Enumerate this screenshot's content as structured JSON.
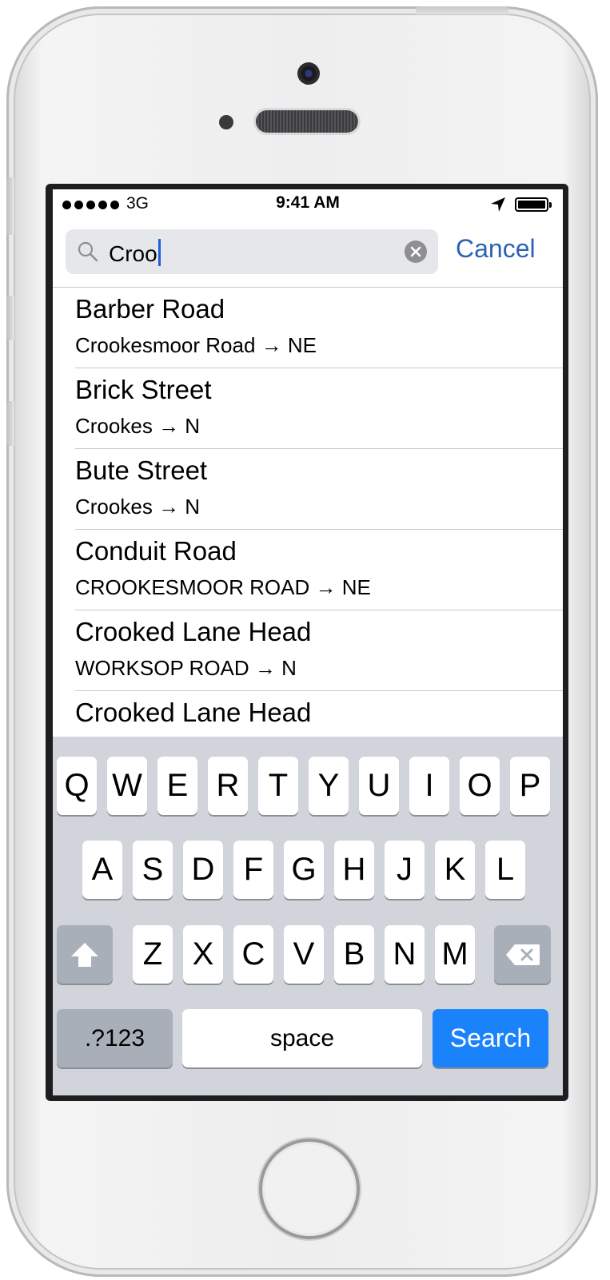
{
  "status_bar": {
    "carrier": "3G",
    "time": "9:41 AM",
    "signal_dots": 5
  },
  "search": {
    "query": "Croo",
    "cancel_label": "Cancel"
  },
  "results": [
    {
      "title": "Barber Road",
      "subtitle": "Crookesmoor Road → NE"
    },
    {
      "title": "Brick Street",
      "subtitle": "Crookes → N"
    },
    {
      "title": "Bute Street",
      "subtitle": "Crookes → N"
    },
    {
      "title": "Conduit Road",
      "subtitle": "CROOKESMOOR ROAD → NE"
    },
    {
      "title": "Crooked Lane Head",
      "subtitle": "WORKSOP ROAD → N"
    },
    {
      "title": "Crooked Lane Head",
      "subtitle": ""
    }
  ],
  "keyboard": {
    "row1": [
      "Q",
      "W",
      "E",
      "R",
      "T",
      "Y",
      "U",
      "I",
      "O",
      "P"
    ],
    "row2": [
      "A",
      "S",
      "D",
      "F",
      "G",
      "H",
      "J",
      "K",
      "L"
    ],
    "row3": [
      "Z",
      "X",
      "C",
      "V",
      "B",
      "N",
      "M"
    ],
    "numbers_label": ".?123",
    "space_label": "space",
    "search_label": "Search",
    "search_key_color": "#1a82fb"
  }
}
